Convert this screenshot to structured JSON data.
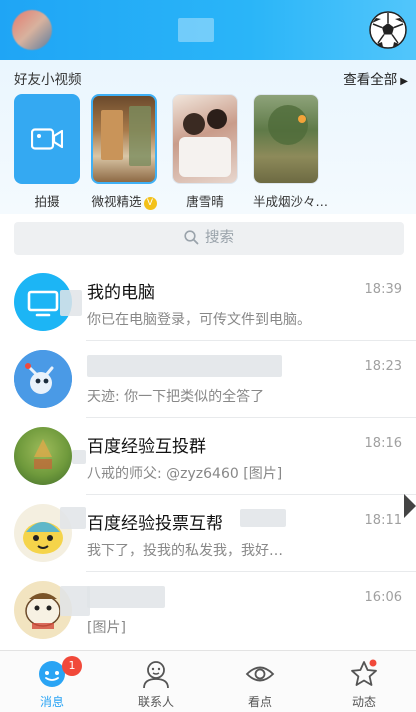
{
  "header": {
    "avatar_icon": "user-avatar",
    "right_icon": "soccer-ball-icon",
    "accent": "#1fa5f5"
  },
  "friends_video": {
    "title": "好友小视频",
    "more_label": "查看全部",
    "items": [
      {
        "label": "拍摄",
        "icon": "video-camera-icon"
      },
      {
        "label": "微视精选",
        "badge": "V"
      },
      {
        "label": "唐雪晴"
      },
      {
        "label": "半成烟沙々…"
      }
    ]
  },
  "search": {
    "placeholder": "搜索"
  },
  "chats": [
    {
      "name": "我的电脑",
      "message": "你已在电脑登录，可传文件到电脑。",
      "time": "18:39"
    },
    {
      "name": "",
      "message": "天迹: 你一下把类似的全答了",
      "time": "18:23"
    },
    {
      "name": "百度经验互投群",
      "message": "八戒的师父: @zyz6460 [图片]",
      "time": "18:16"
    },
    {
      "name": "百度经验投票互帮",
      "message": "我下了，投我的私发我，我好…",
      "time": "18:11"
    },
    {
      "name": "",
      "message": "[图片]",
      "time": "16:06"
    }
  ],
  "tabbar": {
    "tabs": [
      {
        "label": "消息",
        "badge": "1"
      },
      {
        "label": "联系人"
      },
      {
        "label": "看点"
      },
      {
        "label": "动态"
      }
    ],
    "active_color": "#2aa4f4",
    "badge_color": "#f1493a"
  }
}
